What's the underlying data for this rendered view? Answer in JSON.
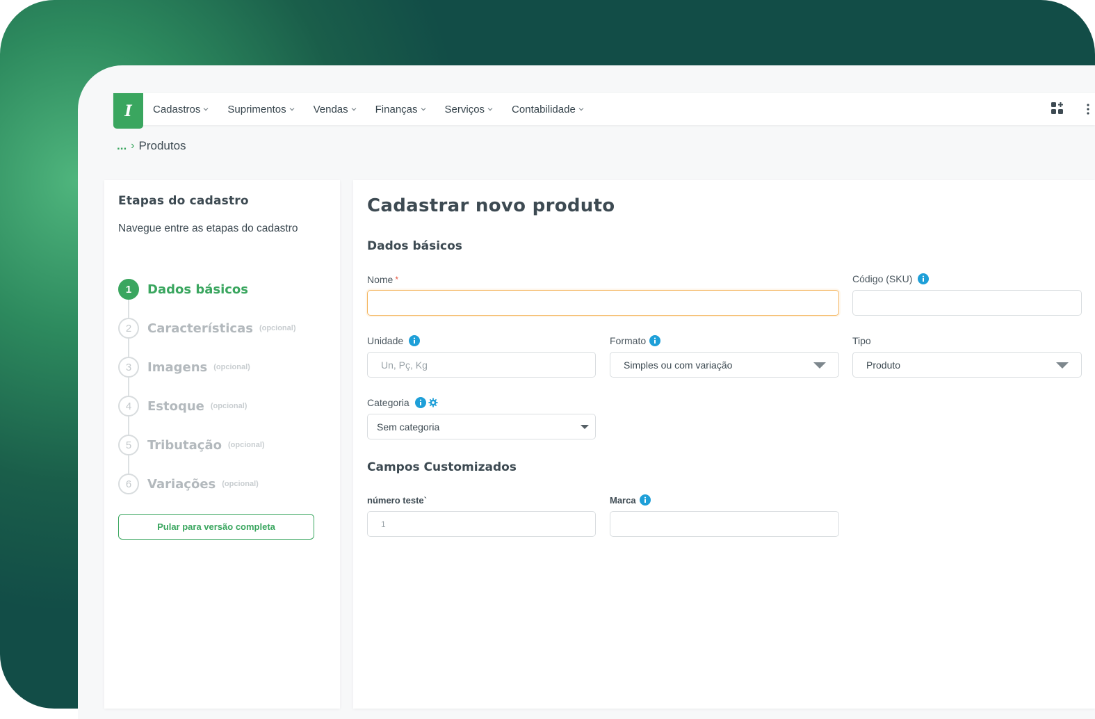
{
  "colors": {
    "brand_green": "#3aa65f",
    "backdrop_dark": "#124d47",
    "focus_orange": "#f4b55e",
    "info_blue": "#1e9fd8",
    "required_red": "#e5533d"
  },
  "logo": {
    "glyph": "I",
    "icon": "erp-logo-icon"
  },
  "nav": {
    "items": [
      {
        "label": "Cadastros"
      },
      {
        "label": "Suprimentos"
      },
      {
        "label": "Vendas"
      },
      {
        "label": "Finanças"
      },
      {
        "label": "Serviços"
      },
      {
        "label": "Contabilidade"
      }
    ],
    "right_icons": [
      "apps-add-icon",
      "more-vertical-icon"
    ]
  },
  "breadcrumb": {
    "ellipsis": "...",
    "separator": "›",
    "current": "Produtos"
  },
  "steps": {
    "title": "Etapas do cadastro",
    "subtitle": "Navegue entre as etapas do cadastro",
    "items": [
      {
        "num": "1",
        "label": "Dados básicos",
        "optional": "",
        "active": true
      },
      {
        "num": "2",
        "label": "Características",
        "optional": "(opcional)",
        "active": false
      },
      {
        "num": "3",
        "label": "Imagens",
        "optional": "(opcional)",
        "active": false
      },
      {
        "num": "4",
        "label": "Estoque",
        "optional": "(opcional)",
        "active": false
      },
      {
        "num": "5",
        "label": "Tributação",
        "optional": "(opcional)",
        "active": false
      },
      {
        "num": "6",
        "label": "Variações",
        "optional": "(opcional)",
        "active": false
      }
    ],
    "skip_button": "Pular para versão completa"
  },
  "form": {
    "title": "Cadastrar novo produto",
    "basic_section": "Dados básicos",
    "nome": {
      "label": "Nome",
      "required_mark": "*",
      "value": ""
    },
    "sku": {
      "label": "Código (SKU)",
      "value": ""
    },
    "unidade": {
      "label": "Unidade",
      "placeholder": "Un, Pç, Kg",
      "value": ""
    },
    "formato": {
      "label": "Formato",
      "value": "Simples ou com variação"
    },
    "tipo": {
      "label": "Tipo",
      "value": "Produto"
    },
    "categoria": {
      "label": "Categoria",
      "value": "Sem categoria"
    },
    "custom_section": "Campos Customizados",
    "numero_teste": {
      "label": "número teste`",
      "placeholder": "1",
      "value": ""
    },
    "marca": {
      "label": "Marca",
      "value": ""
    }
  }
}
